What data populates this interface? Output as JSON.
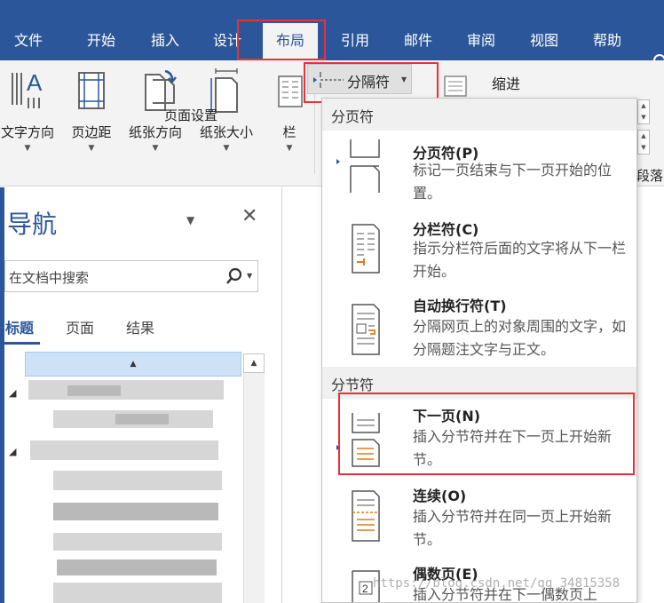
{
  "ribbon": {
    "tabs": [
      {
        "label": "文件",
        "active": false
      },
      {
        "label": "开始",
        "active": false
      },
      {
        "label": "插入",
        "active": false
      },
      {
        "label": "设计",
        "active": false
      },
      {
        "label": "布局",
        "active": true
      },
      {
        "label": "引用",
        "active": false
      },
      {
        "label": "邮件",
        "active": false
      },
      {
        "label": "审阅",
        "active": false
      },
      {
        "label": "视图",
        "active": false
      },
      {
        "label": "帮助",
        "active": false
      }
    ],
    "page_setup": {
      "buttons": [
        "文字方向",
        "页边距",
        "纸张方向",
        "纸张大小",
        "栏"
      ],
      "group_label": "页面设置"
    },
    "breaks_button": "分隔符",
    "indent_label": "缩进",
    "paragraph_label": "段落"
  },
  "nav_pane": {
    "title": "导航",
    "search_placeholder": "在文档中搜索",
    "tabs": [
      "标题",
      "页面",
      "结果"
    ],
    "active_tab": "标题"
  },
  "breaks_menu": {
    "section_page": "分页符",
    "section_section": "分节符",
    "items": [
      {
        "title": "分页符(P)",
        "desc": "标记一页结束与下一页开始的位置。",
        "icon": "page-break-icon"
      },
      {
        "title": "分栏符(C)",
        "desc": "指示分栏符后面的文字将从下一栏开始。",
        "icon": "column-break-icon"
      },
      {
        "title": "自动换行符(T)",
        "desc": "分隔网页上的对象周围的文字，如分隔题注文字与正文。",
        "icon": "text-wrapping-break-icon"
      },
      {
        "title": "下一页(N)",
        "desc": "插入分节符并在下一页上开始新节。",
        "icon": "next-page-section-icon"
      },
      {
        "title": "连续(O)",
        "desc": "插入分节符并在同一页上开始新节。",
        "icon": "continuous-section-icon"
      },
      {
        "title": "偶数页(E)",
        "desc": "插入分节符并在下一偶数页上",
        "icon": "even-page-section-icon"
      }
    ]
  },
  "watermark": "https://blog.csdn.net/qq_34815358",
  "colors": {
    "accent": "#2b579a",
    "highlight": "#e8303a",
    "selected_bg": "#cde1f7"
  }
}
